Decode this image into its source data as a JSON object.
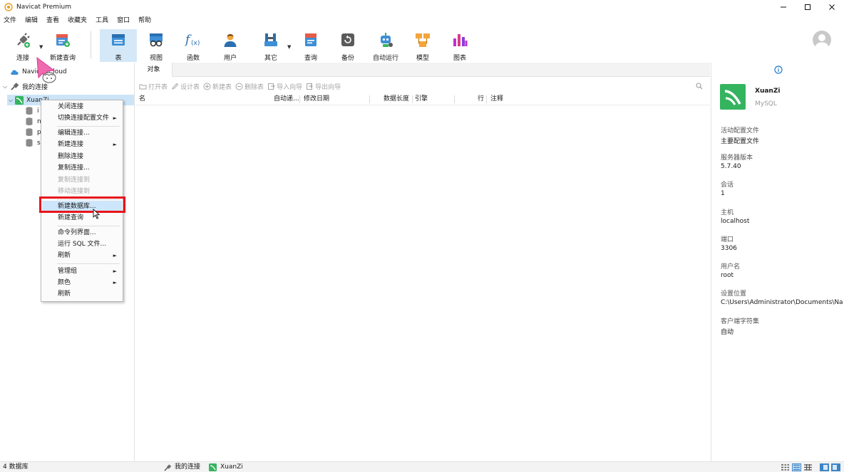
{
  "window": {
    "title": "Navicat Premium"
  },
  "menubar": [
    "文件",
    "编辑",
    "查看",
    "收藏夹",
    "工具",
    "窗口",
    "帮助"
  ],
  "toolbar": {
    "items": [
      {
        "id": "connect",
        "label": "连接",
        "icon": "plug-icon",
        "dropdown": true
      },
      {
        "id": "new-query",
        "label": "新建查询",
        "icon": "new-query-icon",
        "dropdown": false
      },
      {
        "id": "table",
        "label": "表",
        "icon": "table-icon",
        "active": true
      },
      {
        "id": "view",
        "label": "视图",
        "icon": "view-icon"
      },
      {
        "id": "function",
        "label": "函数",
        "icon": "function-icon"
      },
      {
        "id": "user",
        "label": "用户",
        "icon": "user-icon"
      },
      {
        "id": "other",
        "label": "其它",
        "icon": "tools-icon",
        "dropdown": true
      },
      {
        "id": "query",
        "label": "查询",
        "icon": "query-icon"
      },
      {
        "id": "backup",
        "label": "备份",
        "icon": "backup-icon"
      },
      {
        "id": "automation",
        "label": "自动运行",
        "icon": "robot-icon"
      },
      {
        "id": "model",
        "label": "模型",
        "icon": "model-icon"
      },
      {
        "id": "chart",
        "label": "图表",
        "icon": "chart-icon"
      }
    ]
  },
  "tree": {
    "cloud": "Navicat Cloud",
    "my_connections": "我的连接",
    "connection": "XuanZi",
    "databases": [
      "i",
      "n",
      "p",
      "s"
    ]
  },
  "context_menu": {
    "items": [
      {
        "label": "关闭连接",
        "enabled": true,
        "submenu": false
      },
      {
        "label": "切换连接配置文件",
        "enabled": true,
        "submenu": true
      },
      {
        "sep": true
      },
      {
        "label": "编辑连接...",
        "enabled": true,
        "submenu": false
      },
      {
        "label": "新建连接",
        "enabled": true,
        "submenu": true
      },
      {
        "label": "删除连接",
        "enabled": true,
        "submenu": false
      },
      {
        "label": "复制连接...",
        "enabled": true,
        "submenu": false
      },
      {
        "label": "复制连接到",
        "enabled": false,
        "submenu": false
      },
      {
        "label": "移动连接到",
        "enabled": false,
        "submenu": false
      },
      {
        "sep": true
      },
      {
        "label": "新建数据库...",
        "enabled": true,
        "submenu": false,
        "highlighted": true
      },
      {
        "label": "新建查询",
        "enabled": true,
        "submenu": false
      },
      {
        "sep": true
      },
      {
        "label": "命令列界面...",
        "enabled": true,
        "submenu": false
      },
      {
        "label": "运行 SQL 文件...",
        "enabled": true,
        "submenu": false
      },
      {
        "label": "刷新",
        "enabled": true,
        "submenu": true
      },
      {
        "sep": true
      },
      {
        "label": "管理组",
        "enabled": true,
        "submenu": true
      },
      {
        "label": "颜色",
        "enabled": true,
        "submenu": true
      },
      {
        "label": "刷新",
        "enabled": true,
        "submenu": false
      }
    ]
  },
  "objects": {
    "tab": "对象",
    "toolbar": [
      "打开表",
      "设计表",
      "新建表",
      "删除表",
      "导入向导",
      "导出向导"
    ],
    "columns": [
      "名",
      "自动递...",
      "修改日期",
      "数据长度",
      "引擎",
      "行",
      "注释"
    ]
  },
  "info": {
    "name": "XuanZi",
    "type": "MySQL",
    "fields": [
      {
        "label": "活动配置文件",
        "value": "主要配置文件"
      },
      {
        "label": "服务器版本",
        "value": "5.7.40"
      },
      {
        "label": "会话",
        "value": "1"
      },
      {
        "label": "主机",
        "value": "localhost"
      },
      {
        "label": "端口",
        "value": "3306"
      },
      {
        "label": "用户名",
        "value": "root"
      },
      {
        "label": "设置位置",
        "value": "C:\\Users\\Administrator\\Documents\\Na"
      },
      {
        "label": "客户端字符集",
        "value": "自动"
      }
    ]
  },
  "status": {
    "db_count": "4 数据库",
    "group": "我的连接",
    "connection": "XuanZi"
  },
  "colors": {
    "accent": "#3c84c6",
    "mysql_green": "#35b45f",
    "highlight_box": "#e8151b",
    "selected_row": "#cce4f7"
  }
}
